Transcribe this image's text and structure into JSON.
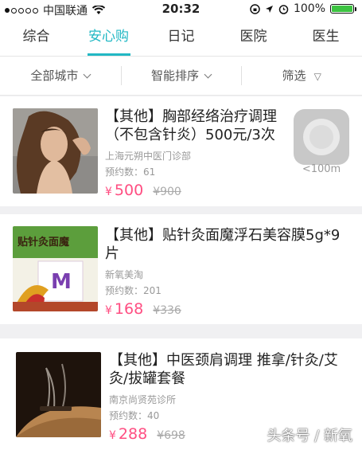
{
  "status_bar": {
    "carrier": "中国联通",
    "time": "20:32",
    "battery": "100%",
    "battery_level": 1.0
  },
  "tabs": [
    {
      "label": "综合",
      "active": false
    },
    {
      "label": "安心购",
      "active": true
    },
    {
      "label": "日记",
      "active": false
    },
    {
      "label": "医院",
      "active": false
    },
    {
      "label": "医生",
      "active": false
    }
  ],
  "filters": {
    "city": "全部城市",
    "sort": "智能排序",
    "filter": "筛选"
  },
  "items": [
    {
      "title": "【其他】胸部经络治疗调理（不包含针炎）500元/3次",
      "clinic": "上海元朔中医门诊部",
      "count": "预约数：61",
      "price": "500",
      "original": "¥900",
      "currency": "¥"
    },
    {
      "title": "【其他】贴针灸面魔浮石美容膜5g*9片",
      "clinic": "新氧美淘",
      "count": "预约数：201",
      "price": "168",
      "original": "¥336",
      "currency": "¥"
    },
    {
      "title": "【其他】中医颈肩调理 推拿/针灸/艾灸/拔罐套餐",
      "clinic": "南京尚贤苑诊所",
      "count": "预约数：40",
      "price": "288",
      "original": "¥698",
      "currency": "¥"
    }
  ],
  "product_box": {
    "banner": "贴针灸面魔",
    "letter": "M"
  },
  "distance": "<100m",
  "watermark": "头条号 / 新氧",
  "colors": {
    "accent": "#22b8c4",
    "price": "#ff4e82"
  }
}
